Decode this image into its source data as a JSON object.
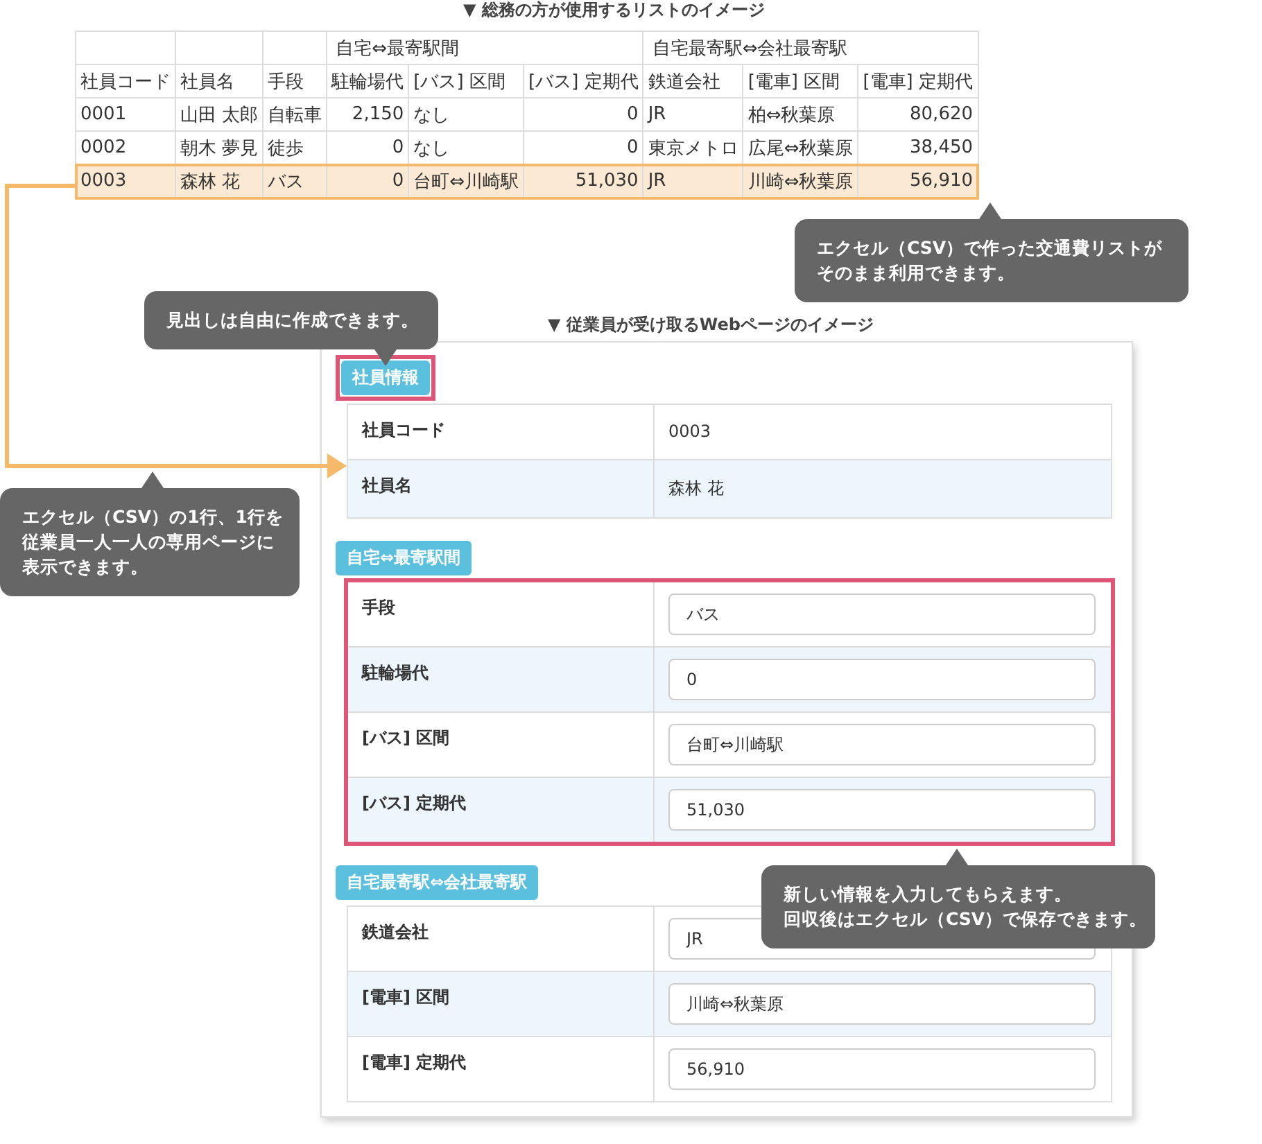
{
  "list_title": "▼ 総務の方が使用するリストのイメージ",
  "table": {
    "column_groups": [
      {
        "columns": [
          {
            "label": "社員コード",
            "kind": "text"
          },
          {
            "label": "社員名",
            "kind": "text"
          },
          {
            "label": "手段",
            "kind": "text"
          }
        ]
      },
      {
        "label": "自宅⇔最寄駅間",
        "columns": [
          {
            "label": "駐輪場代",
            "kind": "number"
          },
          {
            "label": "[バス] 区間",
            "kind": "text"
          },
          {
            "label": "[バス] 定期代",
            "kind": "number"
          }
        ]
      },
      {
        "label": "自宅最寄駅⇔会社最寄駅",
        "columns": [
          {
            "label": "鉄道会社",
            "kind": "text"
          },
          {
            "label": "[電車] 区間",
            "kind": "text"
          },
          {
            "label": "[電車] 定期代",
            "kind": "number"
          }
        ]
      }
    ],
    "rows": [
      {
        "selected": false,
        "cells": [
          "0001",
          "山田 太郎",
          "自転車",
          "2,150",
          "なし",
          "0",
          "JR",
          "柏⇔秋葉原",
          "80,620"
        ]
      },
      {
        "selected": false,
        "cells": [
          "0002",
          "朝木 夢見",
          "徒歩",
          "0",
          "なし",
          "0",
          "東京メトロ",
          "広尾⇔秋葉原",
          "38,450"
        ]
      },
      {
        "selected": true,
        "cells": [
          "0003",
          "森林 花",
          "バス",
          "0",
          "台町⇔川崎駅",
          "51,030",
          "JR",
          "川崎⇔秋葉原",
          "56,910"
        ]
      }
    ]
  },
  "page_title": "▼ 従業員が受け取るWebページのイメージ",
  "sections": [
    {
      "heading": "社員情報",
      "heading_highlighted": true,
      "table_highlighted": false,
      "fields": [
        {
          "label": "社員コード",
          "value": "0003",
          "kind": "static"
        },
        {
          "label": "社員名",
          "value": "森林 花",
          "kind": "static"
        }
      ]
    },
    {
      "heading": "自宅⇔最寄駅間",
      "heading_highlighted": false,
      "table_highlighted": true,
      "fields": [
        {
          "label": "手段",
          "value": "バス",
          "kind": "input"
        },
        {
          "label": "駐輪場代",
          "value": "0",
          "kind": "input"
        },
        {
          "label": "[バス] 区間",
          "value": "台町⇔川崎駅",
          "kind": "input"
        },
        {
          "label": "[バス] 定期代",
          "value": "51,030",
          "kind": "input"
        }
      ]
    },
    {
      "heading": "自宅最寄駅⇔会社最寄駅",
      "heading_highlighted": false,
      "table_highlighted": false,
      "fields": [
        {
          "label": "鉄道会社",
          "value": "JR",
          "kind": "input"
        },
        {
          "label": "[電車] 区間",
          "value": "川崎⇔秋葉原",
          "kind": "input"
        },
        {
          "label": "[電車] 定期代",
          "value": "56,910",
          "kind": "input"
        }
      ]
    }
  ],
  "callouts": [
    {
      "lines": [
        "エクセル（CSV）で作った交通費リストが",
        "そのまま利用できます。"
      ]
    },
    {
      "lines": [
        "見出しは自由に作成できます。"
      ]
    },
    {
      "lines": [
        "エクセル（CSV）の1行、1行を",
        "従業員一人一人の専用ページに",
        "表示できます。"
      ]
    },
    {
      "lines": [
        "新しい情報を入力してもらえます。",
        "回収後はエクセル（CSV）で保存できます。"
      ]
    }
  ]
}
